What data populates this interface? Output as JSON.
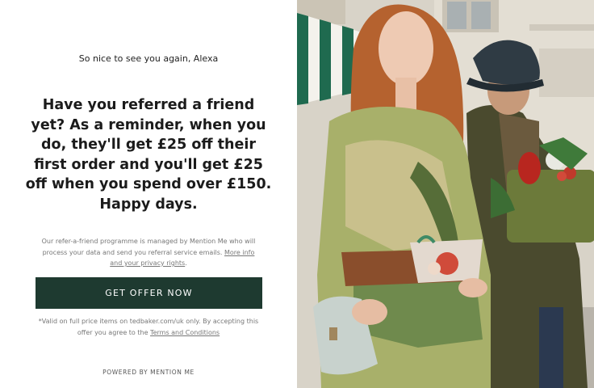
{
  "greeting": "So nice to see you again, Alexa",
  "headline": "Have you referred a friend yet? As a reminder, when you do, they'll get £25 off their first order and you'll get £25 off when you spend over £150. Happy days.",
  "disclaimer": {
    "text": "Our refer-a-friend programme is managed by Mention Me who will process your data and send you referral service emails.",
    "link": "More info and your privacy rights",
    "suffix": "."
  },
  "cta_label": "GET OFFER NOW",
  "terms": {
    "text": "*Valid on full price items on tedbaker.com/uk only. By accepting this offer you agree to the",
    "link": "Terms and Conditions"
  },
  "powered_by": "POWERED BY MENTION ME",
  "colors": {
    "cta_background": "#1e3a30",
    "cta_text": "#ffffff"
  }
}
